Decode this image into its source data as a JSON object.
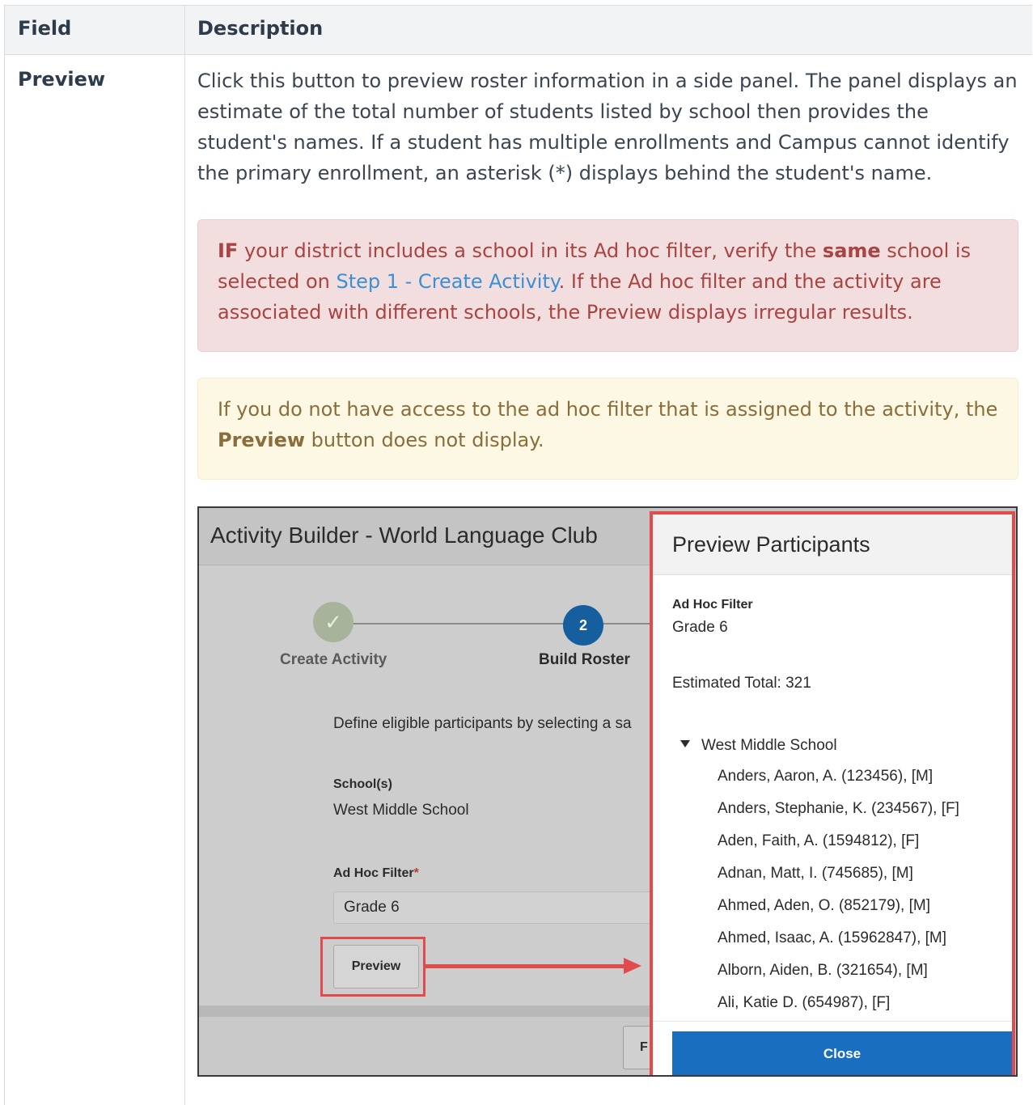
{
  "table": {
    "headers": [
      "Field",
      "Description"
    ],
    "row": {
      "field": "Preview",
      "description": "Click this button to preview roster information in a side panel. The panel displays an estimate of the total number of students listed by school then provides the student's names. If a student has multiple enrollments and Campus cannot identify the primary enrollment, an asterisk (*) displays behind the student's name."
    }
  },
  "danger_callout": {
    "lead": "IF",
    "text1": " your district includes a school in its Ad hoc filter, verify the ",
    "emph": "same",
    "text2": " school is selected on ",
    "link": "Step 1 - Create Activity",
    "text3": ". If the Ad hoc filter and the activity are associated with different schools, the Preview displays irregular results."
  },
  "warning_callout": {
    "text1": "If you do not have access to the ad hoc filter that is assigned to the activity, the ",
    "emph": "Preview",
    "text2": " button does not display."
  },
  "screenshot": {
    "title": "Activity Builder - World Language Club",
    "step1": {
      "icon": "✓",
      "label": "Create Activity"
    },
    "step2": {
      "number": "2",
      "label": "Build Roster"
    },
    "define_text": "Define eligible participants by selecting a sa",
    "school_label": "School(s)",
    "school_value": "West Middle School",
    "adhoc_label": "Ad Hoc Filter",
    "adhoc_required": "*",
    "adhoc_value": "Grade 6",
    "preview_button": "Preview",
    "footer_button": "F",
    "panel": {
      "title": "Preview Participants",
      "filter_label": "Ad Hoc Filter",
      "filter_value": "Grade 6",
      "estimated_total": "Estimated Total: 321",
      "school": "West Middle School",
      "students": [
        "Anders, Aaron, A. (123456), [M]",
        "Anders, Stephanie, K. (234567), [F]",
        "Aden, Faith, A. (1594812), [F]",
        "Adnan, Matt, I. (745685), [M]",
        "Ahmed, Aden, O. (852179), [M]",
        "Ahmed, Isaac, A. (15962847), [M]",
        "Alborn, Aiden, B. (321654), [M]",
        "Ali, Katie D. (654987), [F]"
      ],
      "close_button": "Close"
    }
  },
  "colors": {
    "danger_bg": "#f2dede",
    "danger_text": "#a94442",
    "warning_bg": "#fcf8e3",
    "warning_text": "#8a6d3b",
    "highlight": "#e24b4b",
    "primary": "#1a6ebf"
  }
}
